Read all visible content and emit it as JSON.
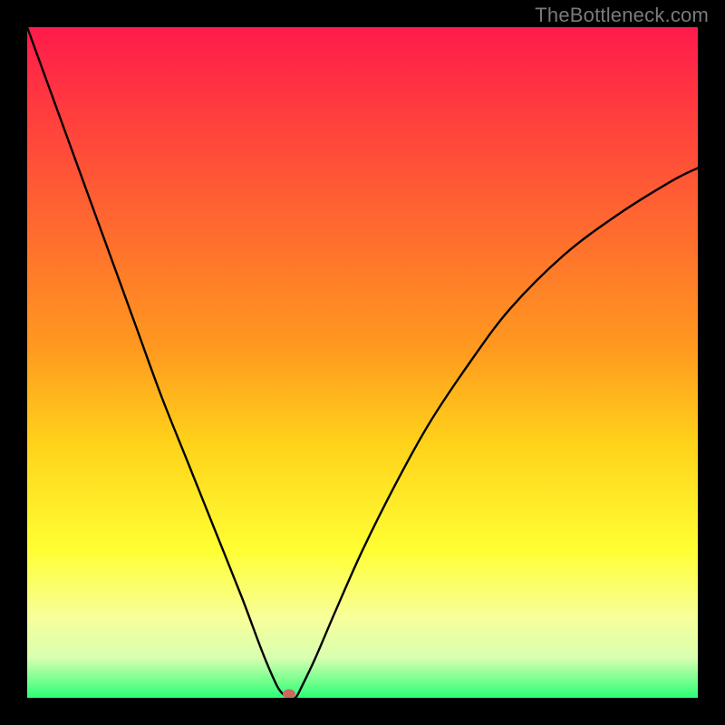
{
  "watermark": "TheBottleneck.com",
  "colors": {
    "frame_bg": "#000000",
    "watermark": "#7a7a7a",
    "curve": "#000000",
    "marker": "#c96a62",
    "gradient_stops": [
      {
        "offset": "0%",
        "color": "#ff1a4b"
      },
      {
        "offset": "12%",
        "color": "#ff3b3f"
      },
      {
        "offset": "30%",
        "color": "#ff6a2f"
      },
      {
        "offset": "48%",
        "color": "#ff9a1f"
      },
      {
        "offset": "62%",
        "color": "#ffd21a"
      },
      {
        "offset": "78%",
        "color": "#ffff33"
      },
      {
        "offset": "88%",
        "color": "#f7ff9a"
      },
      {
        "offset": "94%",
        "color": "#d9ffb0"
      },
      {
        "offset": "100%",
        "color": "#2bff76"
      }
    ]
  },
  "chart_data": {
    "type": "line",
    "title": "",
    "xlabel": "",
    "ylabel": "",
    "xlim": [
      0,
      100
    ],
    "ylim": [
      0,
      100
    ],
    "note": "x: normalized horizontal position (% of plot width). y: normalized bottleneck magnitude (% of plot height, 0 = bottom/green, 100 = top/red). Curve plunges from top-left to ~0 near x≈39 then rises toward upper right.",
    "x": [
      0,
      4,
      8,
      12,
      16,
      20,
      24,
      28,
      32,
      35,
      37,
      38,
      39,
      40,
      41,
      43,
      46,
      50,
      55,
      60,
      66,
      72,
      80,
      88,
      96,
      100
    ],
    "y": [
      100,
      89,
      78,
      67,
      56,
      45,
      35,
      25,
      15,
      7,
      2.3,
      0.7,
      0,
      0,
      1.8,
      6,
      13,
      22,
      32,
      41,
      50,
      58,
      66,
      72,
      77,
      79
    ],
    "marker": {
      "x": 39,
      "y": 0
    },
    "background_gradient": "vertical red→orange→yellow→pale→green (top→bottom) indicating bottleneck severity"
  }
}
